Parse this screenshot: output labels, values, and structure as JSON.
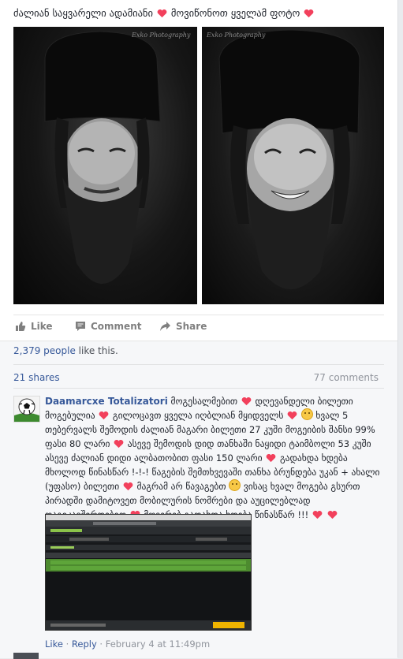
{
  "post": {
    "caption_parts": [
      "ძალიან საყვარელი ადამიანი",
      "მოვიწონოთ ყველამ ფოტო"
    ],
    "watermark_left": "Exko Photography",
    "watermark_right": "Exko Photography"
  },
  "actions": {
    "like_label": "Like",
    "comment_label": "Comment",
    "share_label": "Share"
  },
  "stats": {
    "likes_count": "2,379 people",
    "likes_suffix": "like this.",
    "shares_label": "21 shares",
    "comments_label": "77 comments"
  },
  "comment": {
    "author": "Daamarcxe Totalizatori",
    "text_1": "მოგესალმებით",
    "text_2": "დღევანდელი ბილეთი მოგებულია",
    "text_3": "გილოცავთ ყველა იღბლიან მყიდველს",
    "text_4": "ხვალ 5 თებერვალს შემოდის ძალიან მაგარი ბილეთი 27 კუში მოგეიბის შანსი 99% ფასი 80 ლარი",
    "text_5": "ასევე შემოდის დიდ თანხაში ნაყიდი ტაიმბოლი 53 კუში ასევე ძალიან დიდი ალბათობით ფასი 150 ლარი",
    "text_6": "გადახდა ხდება მხოლოდ წინასწარ !-!-! წაგების შემთხვევაში თანხა ბრუნდება უკან + ახალი (უფასო) ბილეთი",
    "text_7": "მაგრამ არ წავაგებთ",
    "text_8": "ვისაც ხვალ მოგება გსურთ პირადში დამიტოვეთ მობილურის ნომრები და აუცილებლად დაგიკავშირდებით",
    "text_9": "მოვერებ გადახდა ხდება წინასწარ !!!",
    "like_link": "Like",
    "dot": "·",
    "reply_link": "Reply",
    "timestamp": "February 4 at 11:49pm"
  },
  "colors": {
    "link": "#365899",
    "heart": "#f2405c",
    "muted": "#90949c"
  }
}
